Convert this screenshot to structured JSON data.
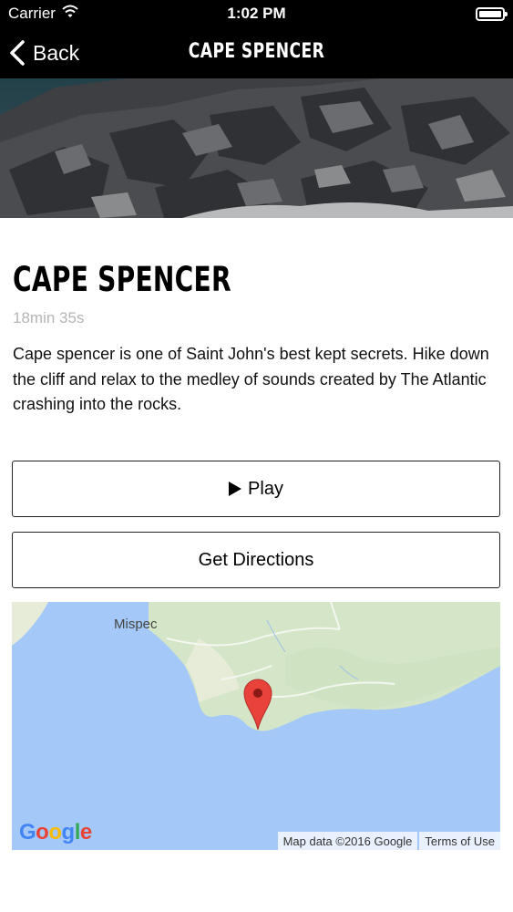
{
  "status_bar": {
    "carrier": "Carrier",
    "time": "1:02 PM"
  },
  "nav": {
    "back_label": "Back",
    "title": "CAPE SPENCER"
  },
  "detail": {
    "heading": "CAPE SPENCER",
    "duration": "18min 35s",
    "description": "Cape spencer is one of Saint John's best kept secrets. Hike down the cliff and relax to the medley of sounds created by The Atlantic crashing into the rocks."
  },
  "actions": {
    "play_label": "Play",
    "directions_label": "Get Directions"
  },
  "map": {
    "place_label": "Mispec",
    "attribution": "Map data ©2016 Google",
    "terms": "Terms of Use",
    "logo_letters": [
      "G",
      "o",
      "o",
      "g",
      "l",
      "e"
    ],
    "colors": {
      "water": "#a4c8f7",
      "land": "#e6ecd8",
      "park": "#cfe3c2",
      "pin": "#e8423a"
    }
  }
}
